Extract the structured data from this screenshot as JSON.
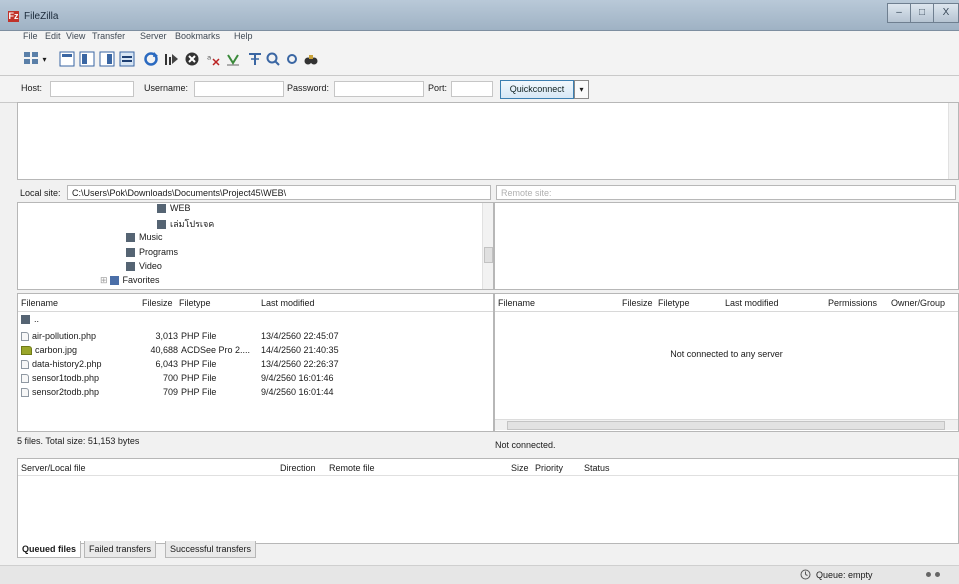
{
  "window": {
    "title": "FileZilla",
    "app_icon": "Fz",
    "min": "–",
    "max": "□",
    "close": "X"
  },
  "menu": [
    "File",
    "Edit",
    "View",
    "Transfer",
    "Server",
    "Bookmarks",
    "Help"
  ],
  "toolbar_icons": [
    "site-manager-icon",
    "dropdown-arrow-icon",
    "toggle-message-log-icon",
    "toggle-local-tree-icon",
    "toggle-remote-tree-icon",
    "toggle-transfer-queue-icon",
    "refresh-icon",
    "process-queue-icon",
    "cancel-icon",
    "disconnect-icon",
    "reconnect-icon",
    "directory-filter-icon",
    "compare-icon",
    "sync-browse-icon",
    "find-files-icon"
  ],
  "quickconnect": {
    "host_label": "Host:",
    "username_label": "Username:",
    "password_label": "Password:",
    "port_label": "Port:",
    "button_label": "Quickconnect",
    "dropdown": "▾"
  },
  "local": {
    "site_label": "Local site:",
    "path": "C:\\Users\\Pok\\Downloads\\Documents\\Project45\\WEB\\",
    "tree": [
      {
        "label": "WEB",
        "level": 3
      },
      {
        "label": "เล่มโปรเจค",
        "level": 3
      },
      {
        "label": "Music",
        "level": 2
      },
      {
        "label": "Programs",
        "level": 2
      },
      {
        "label": "Video",
        "level": 2
      },
      {
        "label": "Favorites",
        "level": 1
      }
    ],
    "columns": {
      "filename": "Filename",
      "filesize": "Filesize",
      "filetype": "Filetype",
      "modified": "Last modified"
    },
    "parent_dir": "..",
    "files": [
      {
        "name": "air-pollution.php",
        "size": "3,013",
        "type": "PHP File",
        "modified": "13/4/2560 22:45:07",
        "icon": "php"
      },
      {
        "name": "carbon.jpg",
        "size": "40,688",
        "type": "ACDSee Pro 2....",
        "modified": "14/4/2560 21:40:35",
        "icon": "img"
      },
      {
        "name": "data-history2.php",
        "size": "6,043",
        "type": "PHP File",
        "modified": "13/4/2560 22:26:37",
        "icon": "php"
      },
      {
        "name": "sensor1todb.php",
        "size": "700",
        "type": "PHP File",
        "modified": "9/4/2560 16:01:46",
        "icon": "php"
      },
      {
        "name": "sensor2todb.php",
        "size": "709",
        "type": "PHP File",
        "modified": "9/4/2560 16:01:44",
        "icon": "php"
      }
    ],
    "summary": "5 files. Total size: 51,153 bytes"
  },
  "remote": {
    "site_label": "Remote site:",
    "columns": {
      "filename": "Filename",
      "filesize": "Filesize",
      "filetype": "Filetype",
      "modified": "Last modified",
      "permissions": "Permissions",
      "owner": "Owner/Group"
    },
    "empty_message": "Not connected to any server",
    "status": "Not connected."
  },
  "queue": {
    "columns": {
      "server_file": "Server/Local file",
      "direction": "Direction",
      "remote_file": "Remote file",
      "size": "Size",
      "priority": "Priority",
      "status": "Status"
    },
    "tabs": [
      "Queued files",
      "Failed transfers",
      "Successful transfers"
    ]
  },
  "statusbar": {
    "queue": "Queue: empty"
  }
}
